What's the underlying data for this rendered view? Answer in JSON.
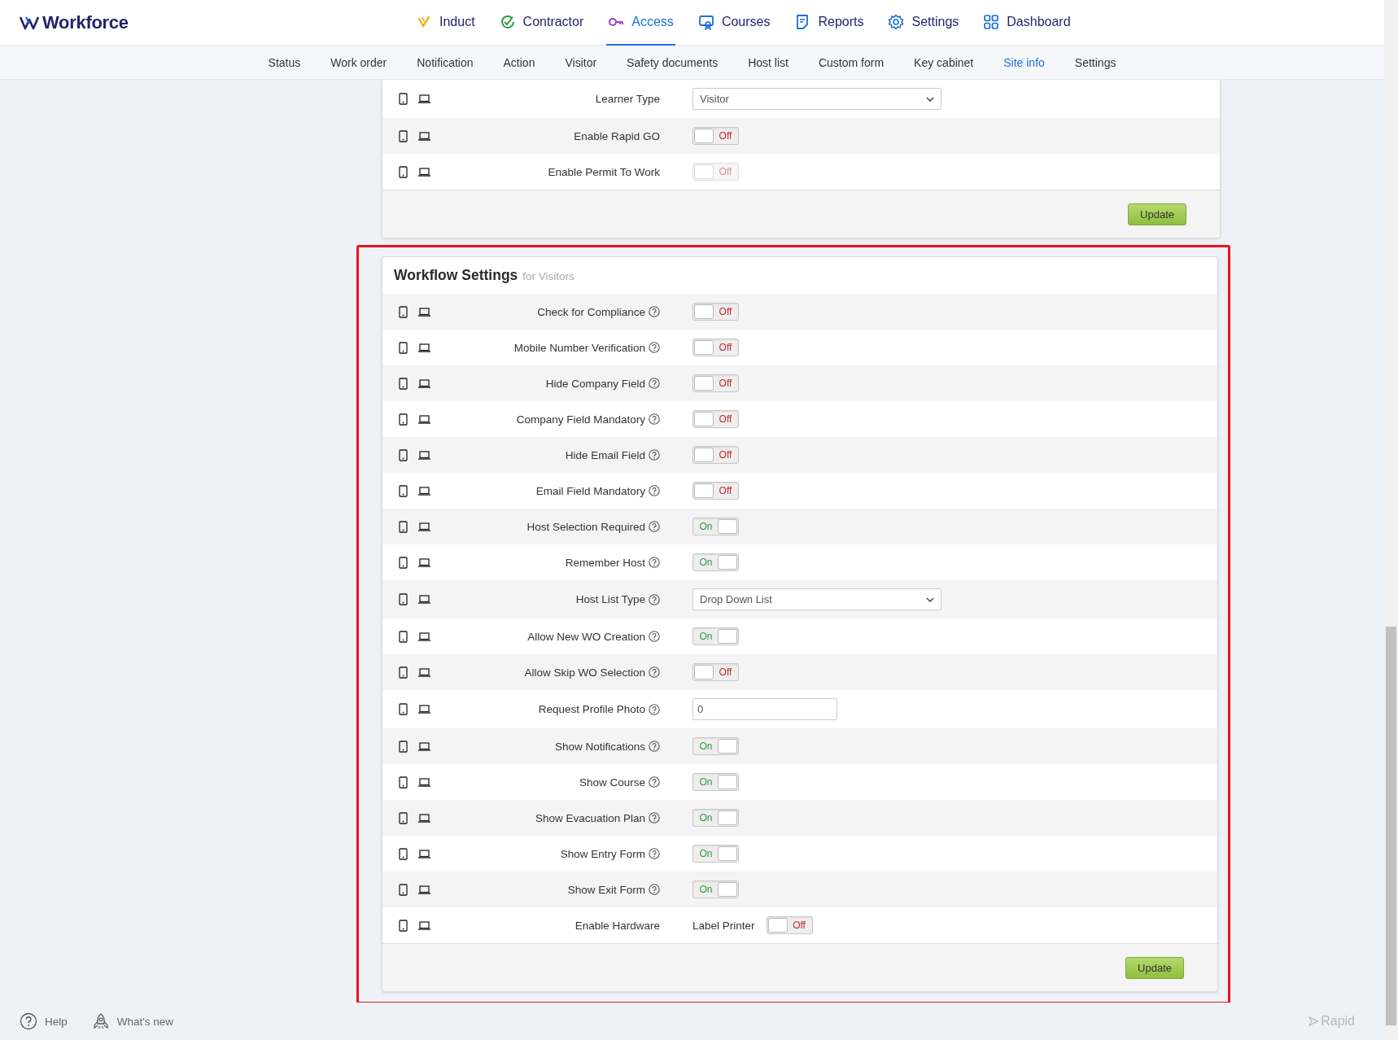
{
  "header": {
    "logo": "Workforce",
    "nav": [
      {
        "label": "Induct",
        "selected": false
      },
      {
        "label": "Contractor",
        "selected": false
      },
      {
        "label": "Access",
        "selected": true
      },
      {
        "label": "Courses",
        "selected": false
      },
      {
        "label": "Reports",
        "selected": false
      },
      {
        "label": "Settings",
        "selected": false
      },
      {
        "label": "Dashboard",
        "selected": false
      }
    ]
  },
  "subnav": [
    {
      "label": "Status",
      "selected": false
    },
    {
      "label": "Work order",
      "selected": false
    },
    {
      "label": "Notification",
      "selected": false
    },
    {
      "label": "Action",
      "selected": false
    },
    {
      "label": "Visitor",
      "selected": false
    },
    {
      "label": "Safety documents",
      "selected": false
    },
    {
      "label": "Host list",
      "selected": false
    },
    {
      "label": "Custom form",
      "selected": false
    },
    {
      "label": "Key cabinet",
      "selected": false
    },
    {
      "label": "Site info",
      "selected": true
    },
    {
      "label": "Settings",
      "selected": false
    }
  ],
  "sections": [
    {
      "highlighted": false,
      "button": "Update",
      "rows": [
        {
          "label": "Learner Type",
          "kind": "select",
          "value": "Visitor",
          "help": false
        },
        {
          "label": "Enable Rapid GO",
          "kind": "toggle",
          "on": false,
          "state_label": "Off",
          "disabled": false,
          "help": false
        },
        {
          "label": "Enable Permit To Work",
          "kind": "toggle",
          "on": false,
          "state_label": "Off",
          "disabled": true,
          "help": false
        }
      ]
    },
    {
      "title": "Workflow Settings",
      "subtitle": "for Visitors",
      "highlighted": true,
      "button": "Update",
      "rows": [
        {
          "label": "Check for Compliance",
          "kind": "toggle",
          "on": false,
          "state_label": "Off",
          "disabled": false,
          "help": true
        },
        {
          "label": "Mobile Number Verification",
          "kind": "toggle",
          "on": false,
          "state_label": "Off",
          "disabled": false,
          "help": true
        },
        {
          "label": "Hide Company Field",
          "kind": "toggle",
          "on": false,
          "state_label": "Off",
          "disabled": false,
          "help": true
        },
        {
          "label": "Company Field Mandatory",
          "kind": "toggle",
          "on": false,
          "state_label": "Off",
          "disabled": false,
          "help": true
        },
        {
          "label": "Hide Email Field",
          "kind": "toggle",
          "on": false,
          "state_label": "Off",
          "disabled": false,
          "help": true
        },
        {
          "label": "Email Field Mandatory",
          "kind": "toggle",
          "on": false,
          "state_label": "Off",
          "disabled": false,
          "help": true
        },
        {
          "label": "Host Selection Required",
          "kind": "toggle",
          "on": true,
          "state_label": "On",
          "disabled": false,
          "help": true
        },
        {
          "label": "Remember Host",
          "kind": "toggle",
          "on": true,
          "state_label": "On",
          "disabled": false,
          "help": true
        },
        {
          "label": "Host List Type",
          "kind": "select",
          "value": "Drop Down List",
          "help": true
        },
        {
          "label": "Allow New WO Creation",
          "kind": "toggle",
          "on": true,
          "state_label": "On",
          "disabled": false,
          "help": true
        },
        {
          "label": "Allow Skip WO Selection",
          "kind": "toggle",
          "on": false,
          "state_label": "Off",
          "disabled": false,
          "help": true
        },
        {
          "label": "Request Profile Photo",
          "kind": "input",
          "value": "0",
          "help": true
        },
        {
          "label": "Show Notifications",
          "kind": "toggle",
          "on": true,
          "state_label": "On",
          "disabled": false,
          "help": true
        },
        {
          "label": "Show Course",
          "kind": "toggle",
          "on": true,
          "state_label": "On",
          "disabled": false,
          "help": true
        },
        {
          "label": "Show Evacuation Plan",
          "kind": "toggle",
          "on": true,
          "state_label": "On",
          "disabled": false,
          "help": true
        },
        {
          "label": "Show Entry Form",
          "kind": "toggle",
          "on": true,
          "state_label": "On",
          "disabled": false,
          "help": true
        },
        {
          "label": "Show Exit Form",
          "kind": "toggle",
          "on": true,
          "state_label": "On",
          "disabled": false,
          "help": true
        },
        {
          "label": "Enable Hardware",
          "kind": "hardware",
          "device": "Label Printer",
          "on": false,
          "state_label": "Off",
          "disabled": false,
          "help": false
        }
      ]
    }
  ],
  "footer": {
    "links": [
      "Help",
      "What's new"
    ],
    "brand": "Rapid"
  }
}
